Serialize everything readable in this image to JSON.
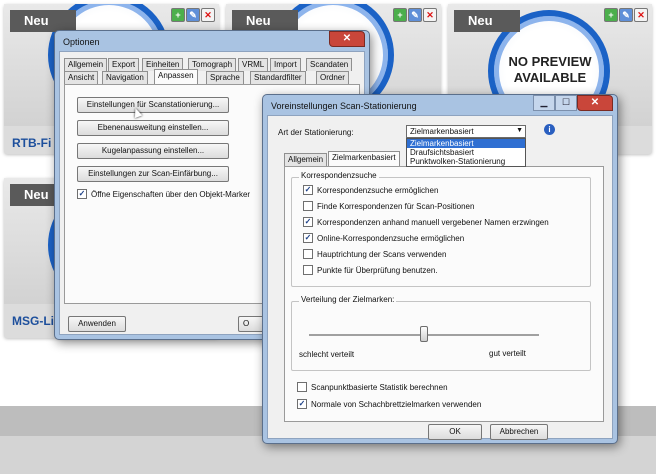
{
  "cards": [
    {
      "badge": "Neu",
      "title": "RTB-Fi"
    },
    {
      "badge": "Neu",
      "title": ""
    },
    {
      "badge": "Neu",
      "title": "",
      "no_preview": [
        "NO PREVIEW",
        "AVAILABLE"
      ]
    },
    {
      "badge": "Neu",
      "title": "MSG-Li"
    }
  ],
  "card_icons": {
    "add": "+",
    "edit": "✎",
    "delete": "✕"
  },
  "optionen": {
    "title": "Optionen",
    "close": "✕",
    "tabs_row1": [
      "Allgemein",
      "Export",
      "Einheiten",
      "Tomograph",
      "VRML",
      "Import",
      "Scandaten"
    ],
    "tabs_row2": [
      "Ansicht",
      "Navigation",
      "Anpassen",
      "Sprache",
      "Standardfilter",
      "Ordner"
    ],
    "active_tab": "Anpassen",
    "buttons": [
      "Einstellungen für Scanstationierung...",
      "Ebenenausweitung einstellen...",
      "Kugelanpassung einstellen...",
      "Einstellungen zur Scan-Einfärbung..."
    ],
    "checkbox_label": "Öffne Eigenschaften über den Objekt-Marker",
    "checkbox_checked": true,
    "apply_button": "Anwenden",
    "ok_partial": "O"
  },
  "scan_dialog": {
    "title": "Voreinstellungen Scan-Stationierung",
    "minimize": "▁",
    "maximize": "☐",
    "close": "✕",
    "art_label": "Art der Stationierung:",
    "dropdown_value": "Zielmarkenbasiert",
    "dropdown_options": [
      "Zielmarkenbasiert",
      "Draufsichtsbasiert",
      "Punktwolken-Stationierung"
    ],
    "info_icon": "i",
    "tabs": [
      "Allgemein",
      "Zielmarkenbasiert"
    ],
    "active_tab": "Zielmarkenbasiert",
    "group_title": "Korrespondenzsuche",
    "options": [
      {
        "label": "Korrespondenzsuche ermöglichen",
        "checked": true
      },
      {
        "label": "Finde Korrespondenzen für Scan-Positionen",
        "checked": false
      },
      {
        "label": "Korrespondenzen anhand manuell vergebener Namen erzwingen",
        "checked": true
      },
      {
        "label": "Online-Korrespondenzsuche ermöglichen",
        "checked": true
      },
      {
        "label": "Hauptrichtung der Scans verwenden",
        "checked": false
      },
      {
        "label": "Punkte für Überprüfung benutzen.",
        "checked": false
      }
    ],
    "slider_title": "Verteilung der Zielmarken:",
    "slider_left": "schlecht verteilt",
    "slider_right": "gut verteilt",
    "slider_value": 0.5,
    "bottom_options": [
      {
        "label": "Scanpunktbasierte Statistik berechnen",
        "checked": false
      },
      {
        "label": "Normale von Schachbrettzielmarken verwenden",
        "checked": true
      }
    ],
    "ok_button": "OK",
    "cancel_button": "Abbrechen"
  },
  "colors": {
    "accent": "#1b62c6",
    "window_frame": "#a9c3e2",
    "title_link": "#1d4f9c"
  }
}
